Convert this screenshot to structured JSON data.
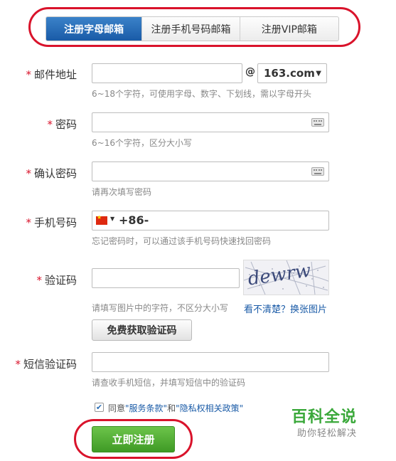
{
  "tabs": [
    {
      "label": "注册字母邮箱",
      "active": true
    },
    {
      "label": "注册手机号码邮箱",
      "active": false
    },
    {
      "label": "注册VIP邮箱",
      "active": false
    }
  ],
  "required_mark": "*",
  "email": {
    "label": "邮件地址",
    "value": "",
    "at": "@",
    "domain": "163.com",
    "hint": "6~18个字符，可使用字母、数字、下划线，需以字母开头"
  },
  "password": {
    "label": "密码",
    "value": "",
    "hint": "6~16个字符，区分大小写"
  },
  "confirm_password": {
    "label": "确认密码",
    "value": "",
    "hint": "请再次填写密码"
  },
  "phone": {
    "label": "手机号码",
    "country_code": "+86-",
    "value": "",
    "hint": "忘记密码时，可以通过该手机号码快速找回密码"
  },
  "captcha": {
    "label": "验证码",
    "value": "",
    "hint": "请填写图片中的字符，不区分大小写",
    "refresh_link": "看不清楚？换张图片",
    "image_text": "dewrw",
    "free_button": "免费获取验证码"
  },
  "sms": {
    "label": "短信验证码",
    "value": "",
    "hint": "请查收手机短信，并填写短信中的验证码"
  },
  "agreement": {
    "checked": true,
    "prefix": "同意",
    "terms": "\"服务条款\"",
    "and": "和",
    "privacy": "\"隐私权相关政策\""
  },
  "submit_label": "立即注册",
  "watermark": {
    "title": "百科全说",
    "subtitle": "助你轻松解决"
  },
  "colors": {
    "required": "#d9132b",
    "tab_active": "#1a5ba7",
    "submit": "#4caf2f",
    "annotation": "#d9132b",
    "watermark": "#3aa83a"
  }
}
